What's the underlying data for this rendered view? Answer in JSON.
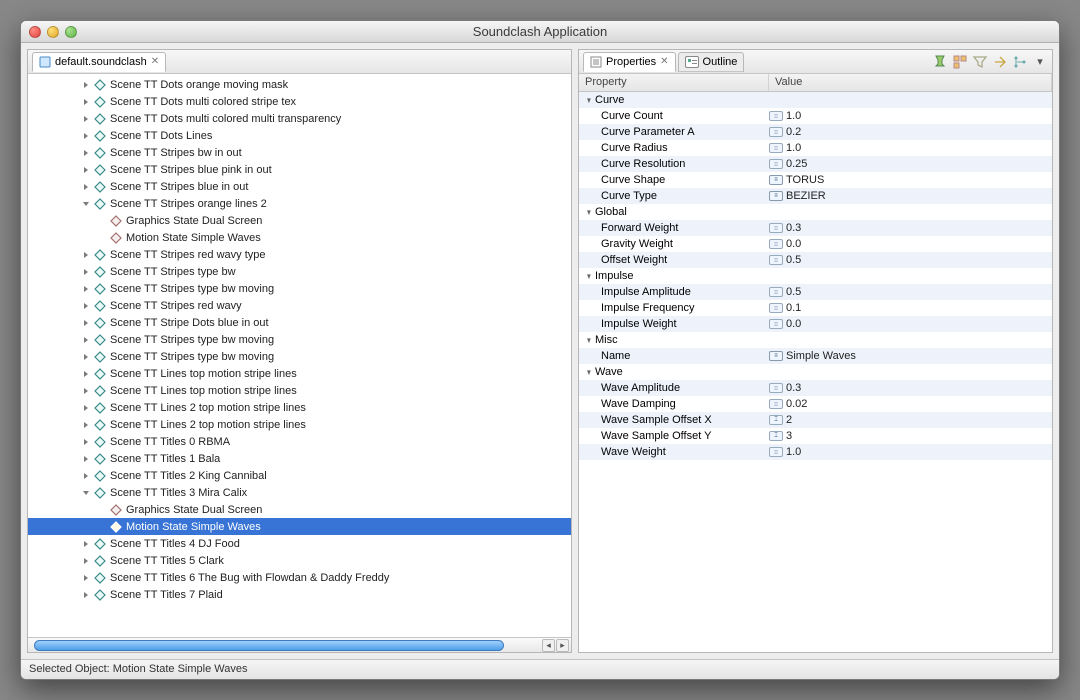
{
  "window": {
    "title": "Soundclash Application"
  },
  "left_tab": {
    "label": "default.soundclash"
  },
  "tree": [
    {
      "level": 2,
      "arrow": "right",
      "icon": "scene",
      "label": "Scene TT Dots orange moving mask"
    },
    {
      "level": 2,
      "arrow": "right",
      "icon": "scene",
      "label": "Scene TT Dots multi colored stripe tex"
    },
    {
      "level": 2,
      "arrow": "right",
      "icon": "scene",
      "label": "Scene TT Dots multi colored multi transparency"
    },
    {
      "level": 2,
      "arrow": "right",
      "icon": "scene",
      "label": "Scene TT Dots Lines"
    },
    {
      "level": 2,
      "arrow": "right",
      "icon": "scene",
      "label": "Scene TT Stripes bw in out"
    },
    {
      "level": 2,
      "arrow": "right",
      "icon": "scene",
      "label": "Scene TT Stripes blue pink in out"
    },
    {
      "level": 2,
      "arrow": "right",
      "icon": "scene",
      "label": "Scene TT Stripes blue in out"
    },
    {
      "level": 2,
      "arrow": "down",
      "icon": "scene",
      "label": "Scene TT Stripes orange lines 2"
    },
    {
      "level": 3,
      "arrow": "none",
      "icon": "state",
      "label": "Graphics State Dual Screen"
    },
    {
      "level": 3,
      "arrow": "none",
      "icon": "state",
      "label": "Motion State Simple Waves"
    },
    {
      "level": 2,
      "arrow": "right",
      "icon": "scene",
      "label": "Scene TT Stripes red wavy type"
    },
    {
      "level": 2,
      "arrow": "right",
      "icon": "scene",
      "label": "Scene TT Stripes type bw"
    },
    {
      "level": 2,
      "arrow": "right",
      "icon": "scene",
      "label": "Scene TT Stripes type bw moving"
    },
    {
      "level": 2,
      "arrow": "right",
      "icon": "scene",
      "label": "Scene TT Stripes red wavy"
    },
    {
      "level": 2,
      "arrow": "right",
      "icon": "scene",
      "label": "Scene TT Stripe Dots blue in out"
    },
    {
      "level": 2,
      "arrow": "right",
      "icon": "scene",
      "label": "Scene TT Stripes type bw moving"
    },
    {
      "level": 2,
      "arrow": "right",
      "icon": "scene",
      "label": "Scene TT Stripes type bw moving"
    },
    {
      "level": 2,
      "arrow": "right",
      "icon": "scene",
      "label": "Scene TT Lines top motion stripe lines"
    },
    {
      "level": 2,
      "arrow": "right",
      "icon": "scene",
      "label": "Scene TT Lines top motion stripe lines"
    },
    {
      "level": 2,
      "arrow": "right",
      "icon": "scene",
      "label": "Scene TT Lines 2 top motion stripe lines"
    },
    {
      "level": 2,
      "arrow": "right",
      "icon": "scene",
      "label": "Scene TT Lines 2 top motion stripe lines"
    },
    {
      "level": 2,
      "arrow": "right",
      "icon": "scene",
      "label": "Scene TT Titles 0 RBMA"
    },
    {
      "level": 2,
      "arrow": "right",
      "icon": "scene",
      "label": "Scene TT Titles 1 Bala"
    },
    {
      "level": 2,
      "arrow": "right",
      "icon": "scene",
      "label": "Scene TT Titles 2  King Cannibal"
    },
    {
      "level": 2,
      "arrow": "down",
      "icon": "scene",
      "label": "Scene TT Titles 3 Mira Calix"
    },
    {
      "level": 3,
      "arrow": "none",
      "icon": "state",
      "label": "Graphics State Dual Screen"
    },
    {
      "level": 3,
      "arrow": "none",
      "icon": "leaf",
      "label": "Motion State Simple Waves",
      "selected": true
    },
    {
      "level": 2,
      "arrow": "right",
      "icon": "scene",
      "label": "Scene TT Titles 4 DJ Food"
    },
    {
      "level": 2,
      "arrow": "right",
      "icon": "scene",
      "label": "Scene TT Titles 5 Clark"
    },
    {
      "level": 2,
      "arrow": "right",
      "icon": "scene",
      "label": "Scene TT Titles 6 The Bug with Flowdan & Daddy Freddy"
    },
    {
      "level": 2,
      "arrow": "right",
      "icon": "scene",
      "label": "Scene TT Titles 7 Plaid"
    }
  ],
  "right_tabs": {
    "properties": "Properties",
    "outline": "Outline"
  },
  "prop_columns": {
    "property": "Property",
    "value": "Value"
  },
  "properties": [
    {
      "type": "group",
      "name": "Curve"
    },
    {
      "type": "num",
      "name": "Curve Count",
      "value": "1.0"
    },
    {
      "type": "num",
      "name": "Curve Parameter A",
      "value": "0.2"
    },
    {
      "type": "num",
      "name": "Curve Radius",
      "value": "1.0"
    },
    {
      "type": "num",
      "name": "Curve Resolution",
      "value": "0.25"
    },
    {
      "type": "enum",
      "name": "Curve Shape",
      "value": "TORUS"
    },
    {
      "type": "enum",
      "name": "Curve Type",
      "value": "BEZIER"
    },
    {
      "type": "group",
      "name": "Global"
    },
    {
      "type": "num",
      "name": "Forward Weight",
      "value": "0.3"
    },
    {
      "type": "num",
      "name": "Gravity Weight",
      "value": "0.0"
    },
    {
      "type": "num",
      "name": "Offset Weight",
      "value": "0.5"
    },
    {
      "type": "group",
      "name": "Impulse"
    },
    {
      "type": "num",
      "name": "Impulse Amplitude",
      "value": "0.5"
    },
    {
      "type": "num",
      "name": "Impulse Frequency",
      "value": "0.1"
    },
    {
      "type": "num",
      "name": "Impulse Weight",
      "value": "0.0"
    },
    {
      "type": "group",
      "name": "Misc"
    },
    {
      "type": "enum",
      "name": "Name",
      "value": "Simple Waves"
    },
    {
      "type": "group",
      "name": "Wave"
    },
    {
      "type": "num",
      "name": "Wave Amplitude",
      "value": "0.3"
    },
    {
      "type": "num",
      "name": "Wave Damping",
      "value": "0.02"
    },
    {
      "type": "int",
      "name": "Wave Sample Offset X",
      "value": "2"
    },
    {
      "type": "int",
      "name": "Wave Sample Offset Y",
      "value": "3"
    },
    {
      "type": "num",
      "name": "Wave Weight",
      "value": "1.0"
    }
  ],
  "status": "Selected Object: Motion State Simple Waves"
}
